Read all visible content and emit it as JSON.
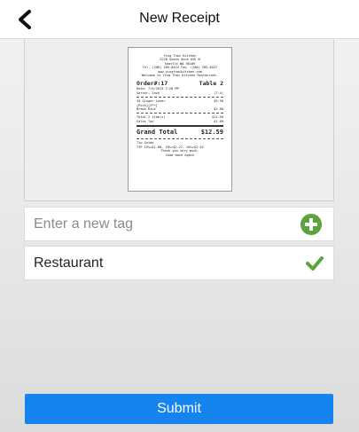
{
  "header": {
    "title": "New Receipt",
    "back_icon": "chevron-left-icon"
  },
  "receipt": {
    "store_name": "Ying Thai Kitchen",
    "address1": "2220 Queen Anne AVE N",
    "address2": "Seattle WA 98109",
    "phone": "Tel. (206) 285-8424 Fax. (206) 285-8427",
    "website": "www.yingthaikitchen.com",
    "welcome": "Welcome to Ying Thai Kitchen Restaurant.",
    "order_label": "Order#:17",
    "table_label": "Table 2",
    "date": "Date: 7/4/2013 7:28 PM",
    "server": "Server: Jack",
    "server_num": "(T.4)",
    "items": [
      {
        "name": "44 Ginger Lover",
        "price": "$9.50"
      },
      {
        "name": "[Pork][2**]",
        "price": ""
      },
      {
        "name": "Brown Rice",
        "price": "$2.00"
      }
    ],
    "total_items_label": "Total 2 item(s)",
    "total_items_value": "$11.50",
    "sales_tax_label": "Sales Tax",
    "sales_tax_value": "$1.09",
    "grand_total_label": "Grand Total",
    "grand_total_value": "$12.59",
    "tip_label": "Tip Guide",
    "tip_values": "TIP 15%=$1.88, 18%=$2.27, 20%=$2.52",
    "thanks": "Thank you very much.",
    "come_back": "Come back again"
  },
  "tag_input": {
    "placeholder": "Enter a new tag",
    "value": "",
    "add_icon": "plus-circle-icon",
    "add_color": "#5aa43c"
  },
  "tags": [
    {
      "label": "Restaurant",
      "icon": "check-icon",
      "color": "#5aa43c"
    }
  ],
  "submit": {
    "label": "Submit",
    "color": "#1584ee"
  }
}
